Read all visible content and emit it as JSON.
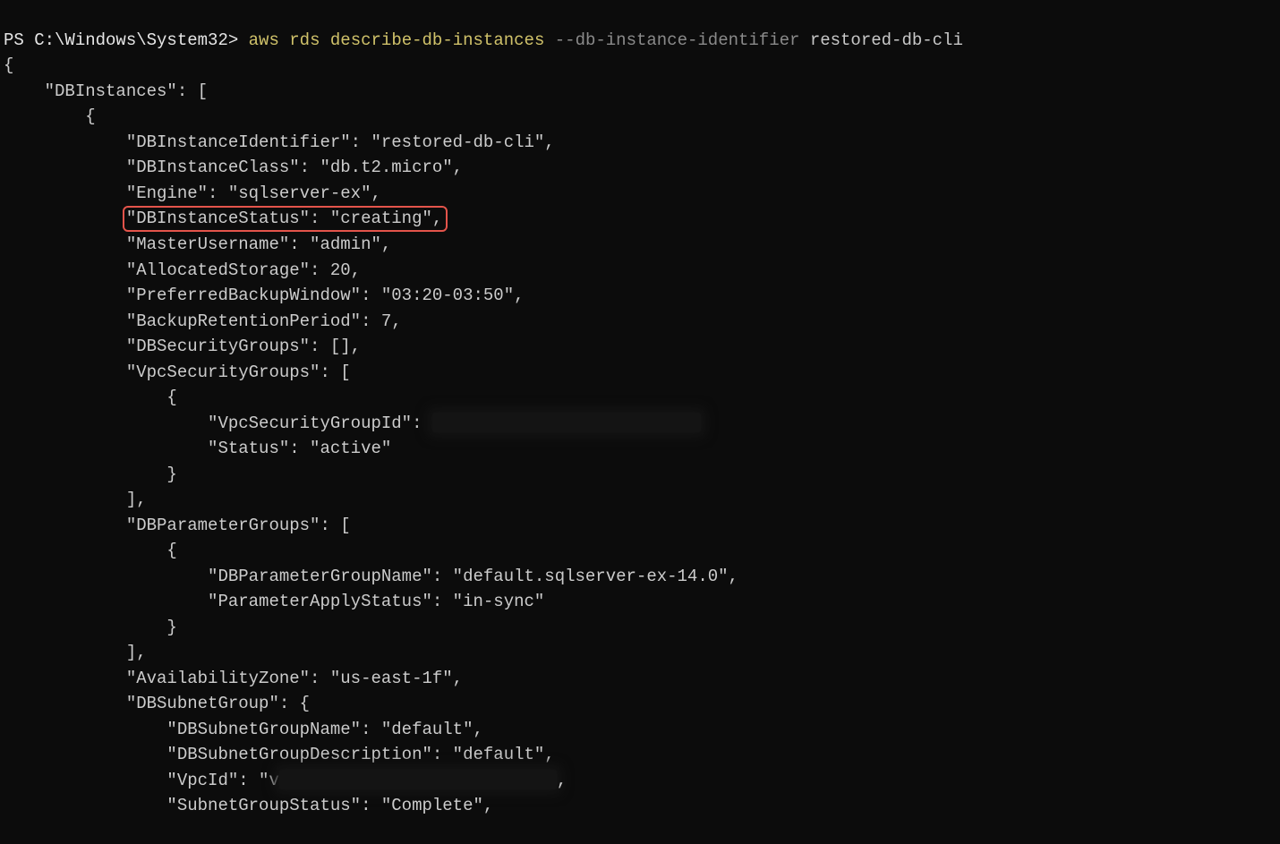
{
  "prompt": {
    "prefix": "PS C:\\Windows\\System32>",
    "cmd_a": "aws",
    "cmd_b": "rds",
    "cmd_c": "describe-db-instances",
    "flag": "--db-instance-identifier",
    "value": "restored-db-cli"
  },
  "lines": {
    "open_brace": "{",
    "db_instances_open": "    \"DBInstances\": [",
    "obj_open": "        {",
    "identifier": "            \"DBInstanceIdentifier\": \"restored-db-cli\",",
    "class": "            \"DBInstanceClass\": \"db.t2.micro\",",
    "engine": "            \"Engine\": \"sqlserver-ex\",",
    "status_inner": "\"DBInstanceStatus\": \"creating\",",
    "master": "            \"MasterUsername\": \"admin\",",
    "alloc": "            \"AllocatedStorage\": 20,",
    "backupwin": "            \"PreferredBackupWindow\": \"03:20-03:50\",",
    "retention": "            \"BackupRetentionPeriod\": 7,",
    "dbsg": "            \"DBSecurityGroups\": [],",
    "vpcsg_open": "            \"VpcSecurityGroups\": [",
    "vpcsg_obj_open": "                {",
    "vpcsg_id_prefix": "                    \"VpcSecurityGroupId\": ",
    "vpcsg_status": "                    \"Status\": \"active\"",
    "vpcsg_obj_close": "                }",
    "vpcsg_close": "            ],",
    "pg_open": "            \"DBParameterGroups\": [",
    "pg_obj_open": "                {",
    "pg_name": "                    \"DBParameterGroupName\": \"default.sqlserver-ex-14.0\",",
    "pg_apply": "                    \"ParameterApplyStatus\": \"in-sync\"",
    "pg_obj_close": "                }",
    "pg_close": "            ],",
    "az": "            \"AvailabilityZone\": \"us-east-1f\",",
    "subnet_open": "            \"DBSubnetGroup\": {",
    "subnet_name": "                \"DBSubnetGroupName\": \"default\",",
    "subnet_desc": "                \"DBSubnetGroupDescription\": \"default\",",
    "vpcid_prefix": "                \"VpcId\": \"v",
    "vpcid_suffix": ",",
    "subnet_status": "                \"SubnetGroupStatus\": \"Complete\","
  }
}
